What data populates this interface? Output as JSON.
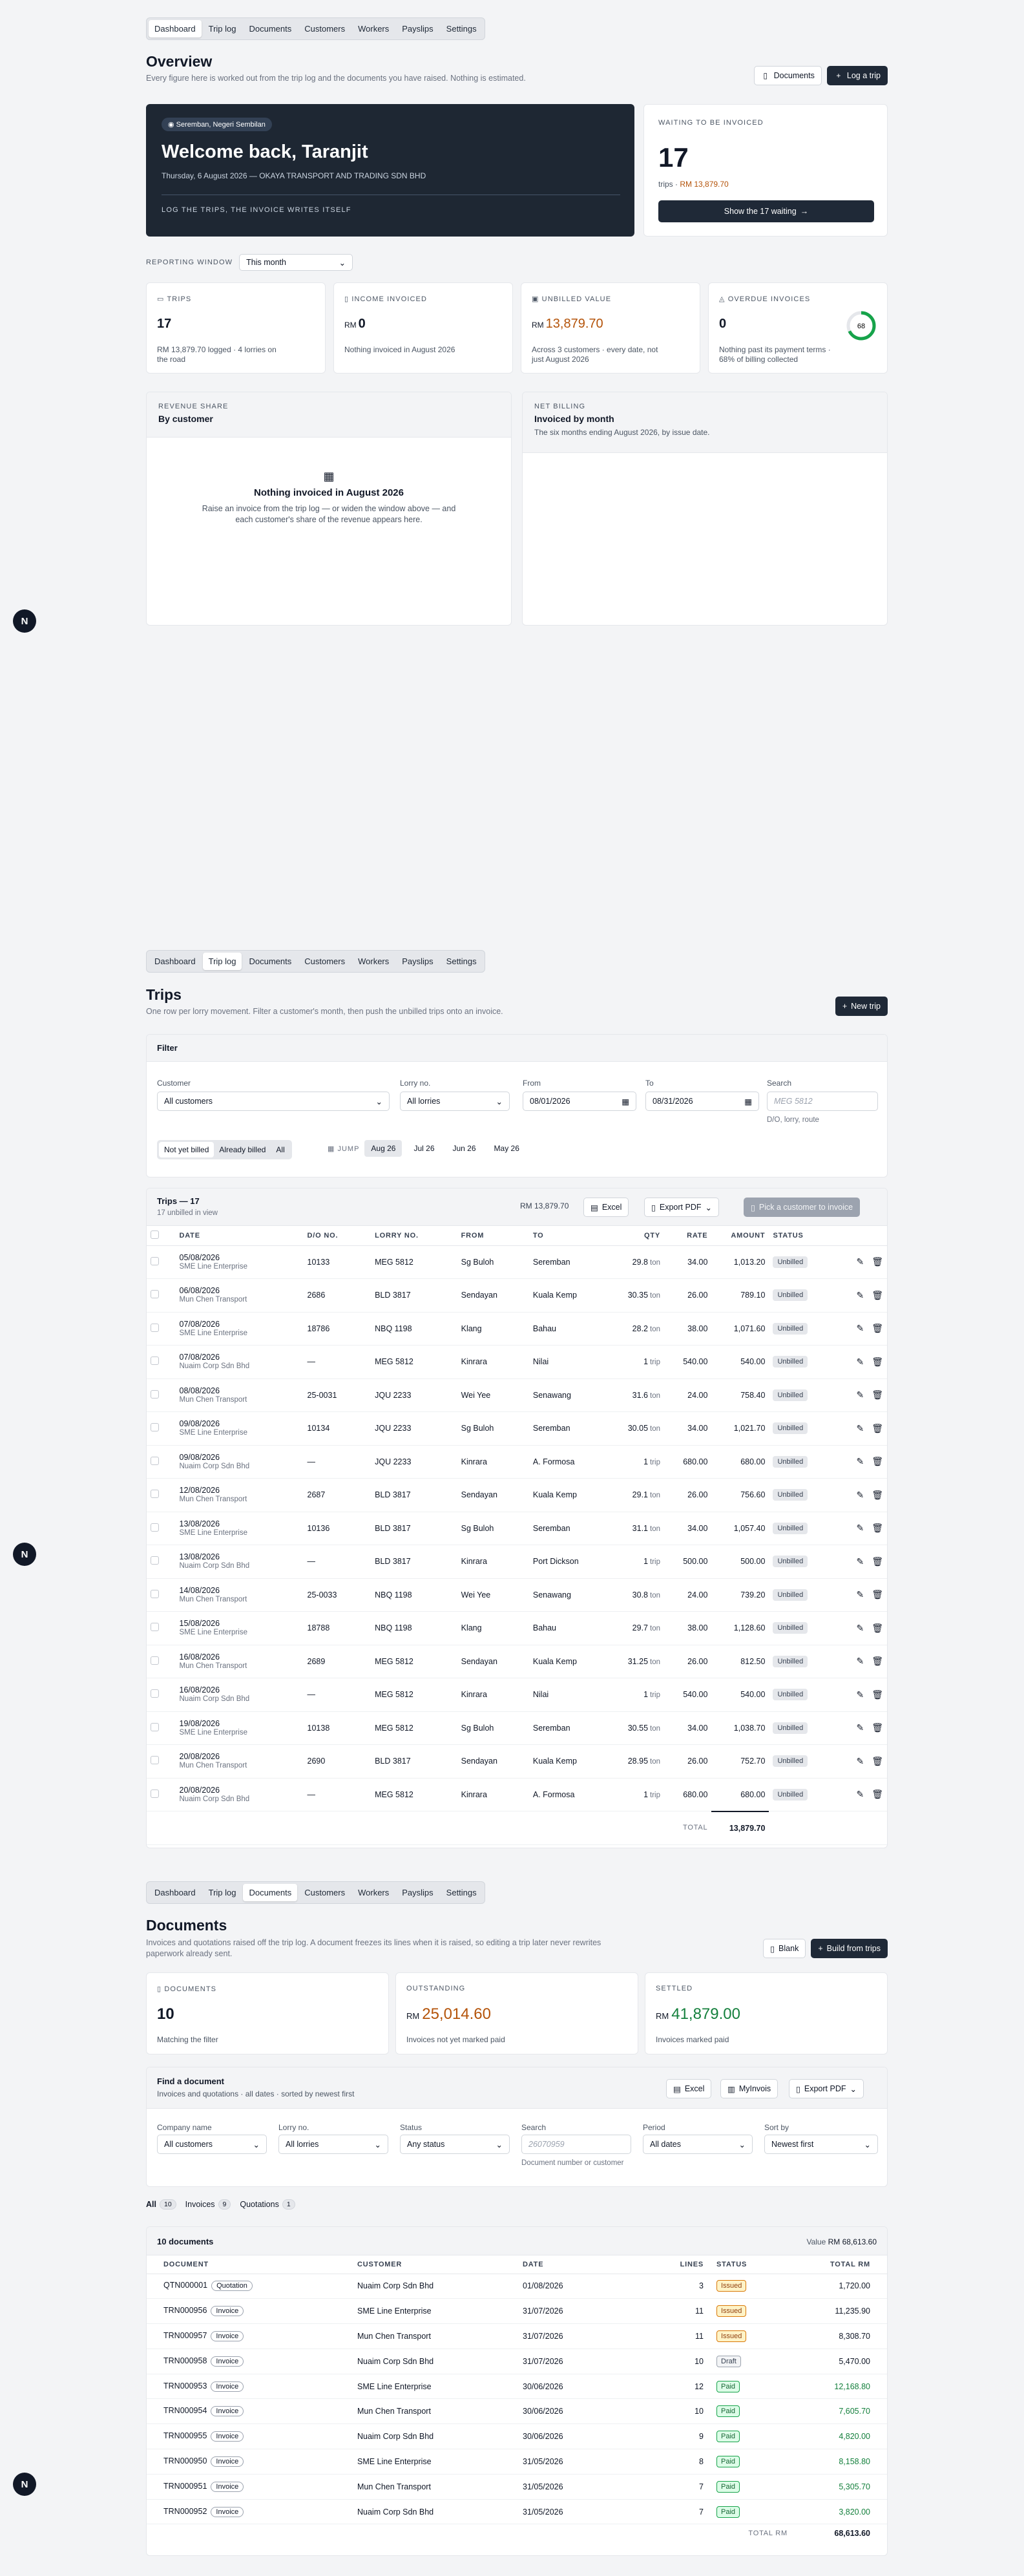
{
  "nav": [
    "Dashboard",
    "Trip log",
    "Documents",
    "Customers",
    "Workers",
    "Payslips",
    "Settings"
  ],
  "side_badge": "N",
  "overview": {
    "title": "Overview",
    "subtitle": "Every figure here is worked out from the trip log and the documents you have raised. Nothing is estimated.",
    "documents_btn": "Documents",
    "log_trip_btn": "Log a trip",
    "location": "Seremban, Negeri Sembilan",
    "welcome": "Welcome back, Taranjit",
    "date_line": "Thursday, 6 August 2026 — OKAYA TRANSPORT AND TRADING SDN BHD",
    "tagline": "LOG THE TRIPS, THE INVOICE WRITES ITSELF",
    "waiting_label": "WAITING TO BE INVOICED",
    "waiting_count": "17",
    "waiting_sub_a": "trips · ",
    "waiting_sub_b": "RM 13,879.70",
    "waiting_btn": "Show the 17 waiting",
    "window_label": "REPORTING WINDOW",
    "window_value": "This month",
    "kpis": [
      {
        "label": "TRIPS",
        "prefix": "",
        "value": "17",
        "note": "RM 13,879.70 logged · 4 lorries on the road"
      },
      {
        "label": "INCOME INVOICED",
        "prefix": "RM",
        "value": "0",
        "note": "Nothing invoiced in August 2026"
      },
      {
        "label": "UNBILLED VALUE",
        "prefix": "RM",
        "value": "13,879.70",
        "note": "Across 3 customers · every date, not just August 2026"
      },
      {
        "label": "OVERDUE INVOICES",
        "prefix": "",
        "value": "0",
        "note": "Nothing past its payment terms · 68% of billing collected",
        "gauge": "68"
      }
    ],
    "share_label": "REVENUE SHARE",
    "share_title": "By customer",
    "share_empty_title": "Nothing invoiced in August 2026",
    "share_empty_text": "Raise an invoice from the trip log — or widen the window above — and each customer's share of the revenue appears here.",
    "net_label": "NET BILLING",
    "net_title": "Invoiced by month",
    "net_sub": "The six months ending August 2026, by issue date."
  },
  "trips": {
    "title": "Trips",
    "subtitle": "One row per lorry movement. Filter a customer's month, then push the unbilled trips onto an invoice.",
    "new_btn": "New trip",
    "filter_title": "Filter",
    "f_customer_label": "Customer",
    "f_customer": "All customers",
    "f_lorry_label": "Lorry no.",
    "f_lorry": "All lorries",
    "f_from_label": "From",
    "f_from": "08/01/2026",
    "f_to_label": "To",
    "f_to": "08/31/2026",
    "f_search_label": "Search",
    "f_search_ph": "MEG 5812",
    "f_search_hint": "D/O, lorry, route",
    "seg": [
      "Not yet billed",
      "Already billed",
      "All"
    ],
    "jump": "JUMP",
    "months": [
      "Aug 26",
      "Jul 26",
      "Jun 26",
      "May 26"
    ],
    "table_title": "Trips — 17",
    "table_sub": "17 unbilled in view",
    "table_total": "RM 13,879.70",
    "excel": "Excel",
    "export": "Export PDF",
    "pick": "Pick a customer to invoice",
    "cols": [
      "DATE",
      "D/O NO.",
      "LORRY NO.",
      "FROM",
      "TO",
      "QTY",
      "RATE",
      "AMOUNT",
      "STATUS"
    ],
    "rows": [
      [
        "05/08/2026",
        "SME Line Enterprise",
        "10133",
        "MEG 5812",
        "Sg Buloh",
        "Seremban",
        "29.8",
        "ton",
        "34.00",
        "1,013.20"
      ],
      [
        "06/08/2026",
        "Mun Chen Transport",
        "2686",
        "BLD 3817",
        "Sendayan",
        "Kuala Kemp",
        "30.35",
        "ton",
        "26.00",
        "789.10"
      ],
      [
        "07/08/2026",
        "SME Line Enterprise",
        "18786",
        "NBQ 1198",
        "Klang",
        "Bahau",
        "28.2",
        "ton",
        "38.00",
        "1,071.60"
      ],
      [
        "07/08/2026",
        "Nuaim Corp Sdn Bhd",
        "—",
        "MEG 5812",
        "Kinrara",
        "Nilai",
        "1",
        "trip",
        "540.00",
        "540.00"
      ],
      [
        "08/08/2026",
        "Mun Chen Transport",
        "25-0031",
        "JQU 2233",
        "Wei Yee",
        "Senawang",
        "31.6",
        "ton",
        "24.00",
        "758.40"
      ],
      [
        "09/08/2026",
        "SME Line Enterprise",
        "10134",
        "JQU 2233",
        "Sg Buloh",
        "Seremban",
        "30.05",
        "ton",
        "34.00",
        "1,021.70"
      ],
      [
        "09/08/2026",
        "Nuaim Corp Sdn Bhd",
        "—",
        "JQU 2233",
        "Kinrara",
        "A. Formosa",
        "1",
        "trip",
        "680.00",
        "680.00"
      ],
      [
        "12/08/2026",
        "Mun Chen Transport",
        "2687",
        "BLD 3817",
        "Sendayan",
        "Kuala Kemp",
        "29.1",
        "ton",
        "26.00",
        "756.60"
      ],
      [
        "13/08/2026",
        "SME Line Enterprise",
        "10136",
        "BLD 3817",
        "Sg Buloh",
        "Seremban",
        "31.1",
        "ton",
        "34.00",
        "1,057.40"
      ],
      [
        "13/08/2026",
        "Nuaim Corp Sdn Bhd",
        "—",
        "BLD 3817",
        "Kinrara",
        "Port Dickson",
        "1",
        "trip",
        "500.00",
        "500.00"
      ],
      [
        "14/08/2026",
        "Mun Chen Transport",
        "25-0033",
        "NBQ 1198",
        "Wei Yee",
        "Senawang",
        "30.8",
        "ton",
        "24.00",
        "739.20"
      ],
      [
        "15/08/2026",
        "SME Line Enterprise",
        "18788",
        "NBQ 1198",
        "Klang",
        "Bahau",
        "29.7",
        "ton",
        "38.00",
        "1,128.60"
      ],
      [
        "16/08/2026",
        "Mun Chen Transport",
        "2689",
        "MEG 5812",
        "Sendayan",
        "Kuala Kemp",
        "31.25",
        "ton",
        "26.00",
        "812.50"
      ],
      [
        "16/08/2026",
        "Nuaim Corp Sdn Bhd",
        "—",
        "MEG 5812",
        "Kinrara",
        "Nilai",
        "1",
        "trip",
        "540.00",
        "540.00"
      ],
      [
        "19/08/2026",
        "SME Line Enterprise",
        "10138",
        "MEG 5812",
        "Sg Buloh",
        "Seremban",
        "30.55",
        "ton",
        "34.00",
        "1,038.70"
      ],
      [
        "20/08/2026",
        "Mun Chen Transport",
        "2690",
        "BLD 3817",
        "Sendayan",
        "Kuala Kemp",
        "28.95",
        "ton",
        "26.00",
        "752.70"
      ],
      [
        "20/08/2026",
        "Nuaim Corp Sdn Bhd",
        "—",
        "MEG 5812",
        "Kinrara",
        "A. Formosa",
        "1",
        "trip",
        "680.00",
        "680.00"
      ]
    ],
    "status": "Unbilled",
    "total_label": "TOTAL",
    "total_value": "13,879.70"
  },
  "documents": {
    "title": "Documents",
    "subtitle": "Invoices and quotations raised off the trip log. A document freezes its lines when it is raised, so editing a trip later never rewrites paperwork already sent.",
    "blank_btn": "Blank",
    "build_btn": "Build from trips",
    "kpis": [
      {
        "label": "DOCUMENTS",
        "prefix": "",
        "value": "10",
        "note": "Matching the filter"
      },
      {
        "label": "OUTSTANDING",
        "prefix": "RM",
        "value": "25,014.60",
        "note": "Invoices not yet marked paid"
      },
      {
        "label": "SETTLED",
        "prefix": "RM",
        "value": "41,879.00",
        "note": "Invoices marked paid"
      }
    ],
    "find_title": "Find a document",
    "find_sub": "Invoices and quotations · all dates · sorted by newest first",
    "excel": "Excel",
    "myinvois": "MyInvois",
    "export": "Export PDF",
    "f_company_label": "Company name",
    "f_company": "All customers",
    "f_lorry_label": "Lorry no.",
    "f_lorry": "All lorries",
    "f_status_label": "Status",
    "f_status": "Any status",
    "f_search_label": "Search",
    "f_search_ph": "26070959",
    "f_search_hint": "Document number or customer",
    "f_period_label": "Period",
    "f_period": "All dates",
    "f_sort_label": "Sort by",
    "f_sort": "Newest first",
    "tabs": [
      {
        "label": "All",
        "count": "10"
      },
      {
        "label": "Invoices",
        "count": "9"
      },
      {
        "label": "Quotations",
        "count": "1"
      }
    ],
    "list_title": "10 documents",
    "list_value_a": "Value ",
    "list_value_b": "RM 68,613.60",
    "cols": [
      "DOCUMENT",
      "CUSTOMER",
      "DATE",
      "LINES",
      "STATUS",
      "TOTAL RM"
    ],
    "rows": [
      [
        "QTN000001",
        "Quotation",
        "Nuaim Corp Sdn Bhd",
        "01/08/2026",
        "3",
        "Issued",
        "1,720.00"
      ],
      [
        "TRN000956",
        "Invoice",
        "SME Line Enterprise",
        "31/07/2026",
        "11",
        "Issued",
        "11,235.90"
      ],
      [
        "TRN000957",
        "Invoice",
        "Mun Chen Transport",
        "31/07/2026",
        "11",
        "Issued",
        "8,308.70"
      ],
      [
        "TRN000958",
        "Invoice",
        "Nuaim Corp Sdn Bhd",
        "31/07/2026",
        "10",
        "Draft",
        "5,470.00"
      ],
      [
        "TRN000953",
        "Invoice",
        "SME Line Enterprise",
        "30/06/2026",
        "12",
        "Paid",
        "12,168.80"
      ],
      [
        "TRN000954",
        "Invoice",
        "Mun Chen Transport",
        "30/06/2026",
        "10",
        "Paid",
        "7,605.70"
      ],
      [
        "TRN000955",
        "Invoice",
        "Nuaim Corp Sdn Bhd",
        "30/06/2026",
        "9",
        "Paid",
        "4,820.00"
      ],
      [
        "TRN000950",
        "Invoice",
        "SME Line Enterprise",
        "31/05/2026",
        "8",
        "Paid",
        "8,158.80"
      ],
      [
        "TRN000951",
        "Invoice",
        "Mun Chen Transport",
        "31/05/2026",
        "7",
        "Paid",
        "5,305.70"
      ],
      [
        "TRN000952",
        "Invoice",
        "Nuaim Corp Sdn Bhd",
        "31/05/2026",
        "7",
        "Paid",
        "3,820.00"
      ]
    ],
    "total_label": "TOTAL RM",
    "total_value": "68,613.60"
  },
  "colors": {
    "ink": "#1f2937",
    "amber": "#b45309",
    "green": "#15803d",
    "gauge": "#16a34a"
  }
}
